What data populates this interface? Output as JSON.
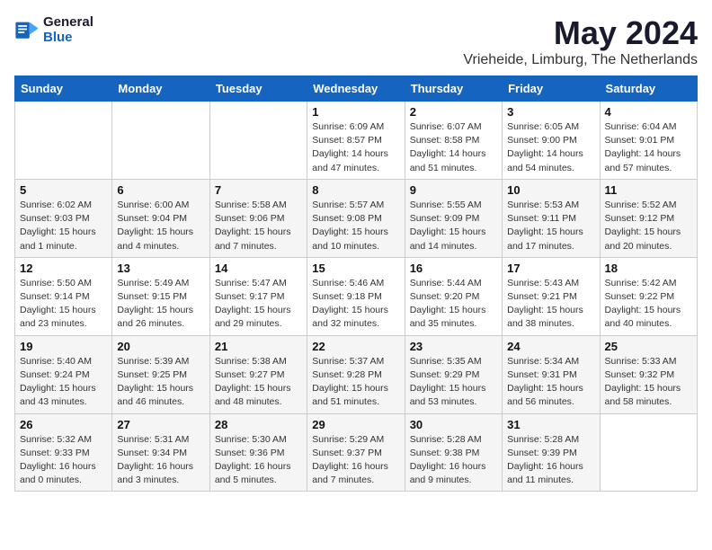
{
  "header": {
    "logo_line1": "General",
    "logo_line2": "Blue",
    "month_title": "May 2024",
    "location": "Vrieheide, Limburg, The Netherlands"
  },
  "weekdays": [
    "Sunday",
    "Monday",
    "Tuesday",
    "Wednesday",
    "Thursday",
    "Friday",
    "Saturday"
  ],
  "weeks": [
    [
      {
        "day": "",
        "info": ""
      },
      {
        "day": "",
        "info": ""
      },
      {
        "day": "",
        "info": ""
      },
      {
        "day": "1",
        "info": "Sunrise: 6:09 AM\nSunset: 8:57 PM\nDaylight: 14 hours and 47 minutes."
      },
      {
        "day": "2",
        "info": "Sunrise: 6:07 AM\nSunset: 8:58 PM\nDaylight: 14 hours and 51 minutes."
      },
      {
        "day": "3",
        "info": "Sunrise: 6:05 AM\nSunset: 9:00 PM\nDaylight: 14 hours and 54 minutes."
      },
      {
        "day": "4",
        "info": "Sunrise: 6:04 AM\nSunset: 9:01 PM\nDaylight: 14 hours and 57 minutes."
      }
    ],
    [
      {
        "day": "5",
        "info": "Sunrise: 6:02 AM\nSunset: 9:03 PM\nDaylight: 15 hours and 1 minute."
      },
      {
        "day": "6",
        "info": "Sunrise: 6:00 AM\nSunset: 9:04 PM\nDaylight: 15 hours and 4 minutes."
      },
      {
        "day": "7",
        "info": "Sunrise: 5:58 AM\nSunset: 9:06 PM\nDaylight: 15 hours and 7 minutes."
      },
      {
        "day": "8",
        "info": "Sunrise: 5:57 AM\nSunset: 9:08 PM\nDaylight: 15 hours and 10 minutes."
      },
      {
        "day": "9",
        "info": "Sunrise: 5:55 AM\nSunset: 9:09 PM\nDaylight: 15 hours and 14 minutes."
      },
      {
        "day": "10",
        "info": "Sunrise: 5:53 AM\nSunset: 9:11 PM\nDaylight: 15 hours and 17 minutes."
      },
      {
        "day": "11",
        "info": "Sunrise: 5:52 AM\nSunset: 9:12 PM\nDaylight: 15 hours and 20 minutes."
      }
    ],
    [
      {
        "day": "12",
        "info": "Sunrise: 5:50 AM\nSunset: 9:14 PM\nDaylight: 15 hours and 23 minutes."
      },
      {
        "day": "13",
        "info": "Sunrise: 5:49 AM\nSunset: 9:15 PM\nDaylight: 15 hours and 26 minutes."
      },
      {
        "day": "14",
        "info": "Sunrise: 5:47 AM\nSunset: 9:17 PM\nDaylight: 15 hours and 29 minutes."
      },
      {
        "day": "15",
        "info": "Sunrise: 5:46 AM\nSunset: 9:18 PM\nDaylight: 15 hours and 32 minutes."
      },
      {
        "day": "16",
        "info": "Sunrise: 5:44 AM\nSunset: 9:20 PM\nDaylight: 15 hours and 35 minutes."
      },
      {
        "day": "17",
        "info": "Sunrise: 5:43 AM\nSunset: 9:21 PM\nDaylight: 15 hours and 38 minutes."
      },
      {
        "day": "18",
        "info": "Sunrise: 5:42 AM\nSunset: 9:22 PM\nDaylight: 15 hours and 40 minutes."
      }
    ],
    [
      {
        "day": "19",
        "info": "Sunrise: 5:40 AM\nSunset: 9:24 PM\nDaylight: 15 hours and 43 minutes."
      },
      {
        "day": "20",
        "info": "Sunrise: 5:39 AM\nSunset: 9:25 PM\nDaylight: 15 hours and 46 minutes."
      },
      {
        "day": "21",
        "info": "Sunrise: 5:38 AM\nSunset: 9:27 PM\nDaylight: 15 hours and 48 minutes."
      },
      {
        "day": "22",
        "info": "Sunrise: 5:37 AM\nSunset: 9:28 PM\nDaylight: 15 hours and 51 minutes."
      },
      {
        "day": "23",
        "info": "Sunrise: 5:35 AM\nSunset: 9:29 PM\nDaylight: 15 hours and 53 minutes."
      },
      {
        "day": "24",
        "info": "Sunrise: 5:34 AM\nSunset: 9:31 PM\nDaylight: 15 hours and 56 minutes."
      },
      {
        "day": "25",
        "info": "Sunrise: 5:33 AM\nSunset: 9:32 PM\nDaylight: 15 hours and 58 minutes."
      }
    ],
    [
      {
        "day": "26",
        "info": "Sunrise: 5:32 AM\nSunset: 9:33 PM\nDaylight: 16 hours and 0 minutes."
      },
      {
        "day": "27",
        "info": "Sunrise: 5:31 AM\nSunset: 9:34 PM\nDaylight: 16 hours and 3 minutes."
      },
      {
        "day": "28",
        "info": "Sunrise: 5:30 AM\nSunset: 9:36 PM\nDaylight: 16 hours and 5 minutes."
      },
      {
        "day": "29",
        "info": "Sunrise: 5:29 AM\nSunset: 9:37 PM\nDaylight: 16 hours and 7 minutes."
      },
      {
        "day": "30",
        "info": "Sunrise: 5:28 AM\nSunset: 9:38 PM\nDaylight: 16 hours and 9 minutes."
      },
      {
        "day": "31",
        "info": "Sunrise: 5:28 AM\nSunset: 9:39 PM\nDaylight: 16 hours and 11 minutes."
      },
      {
        "day": "",
        "info": ""
      }
    ]
  ]
}
